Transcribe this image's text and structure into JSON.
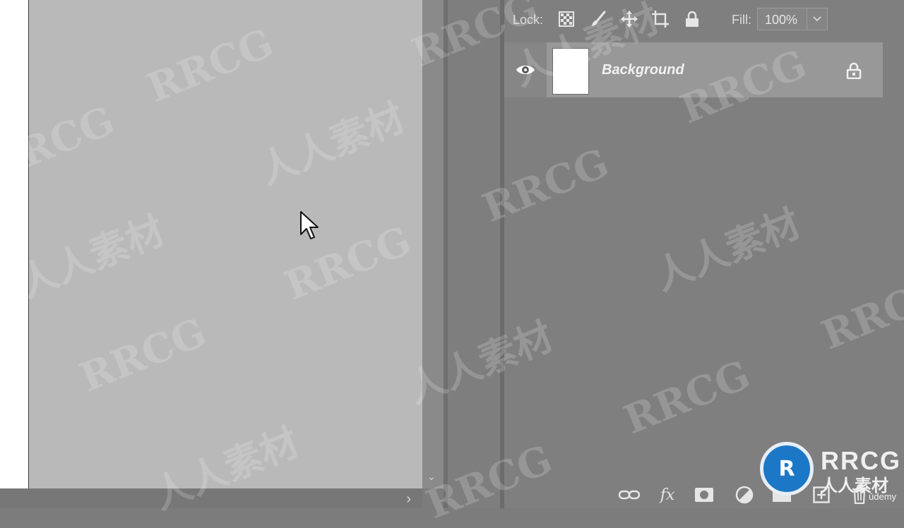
{
  "layers_panel": {
    "lock_label": "Lock:",
    "lock_icons": [
      "lock-transparent-pixels-icon",
      "lock-image-pixels-icon",
      "lock-position-icon",
      "lock-artboard-icon",
      "lock-all-icon"
    ],
    "fill_label": "Fill:",
    "fill_value": "100%",
    "layers": [
      {
        "name": "Background",
        "visible": true,
        "locked": true
      }
    ],
    "bottom_icons": [
      "link-layers-icon",
      "fx-icon",
      "add-mask-icon",
      "adjustment-layer-icon",
      "group-icon",
      "new-layer-icon",
      "delete-icon"
    ],
    "fx_label": "fx"
  },
  "watermark": {
    "latin": "RRCG",
    "cjk": "人人素材"
  },
  "brand": {
    "name": "RRCG",
    "cjk": "人人素材",
    "partner": "ûdemy",
    "accent": "#1c78c6"
  }
}
